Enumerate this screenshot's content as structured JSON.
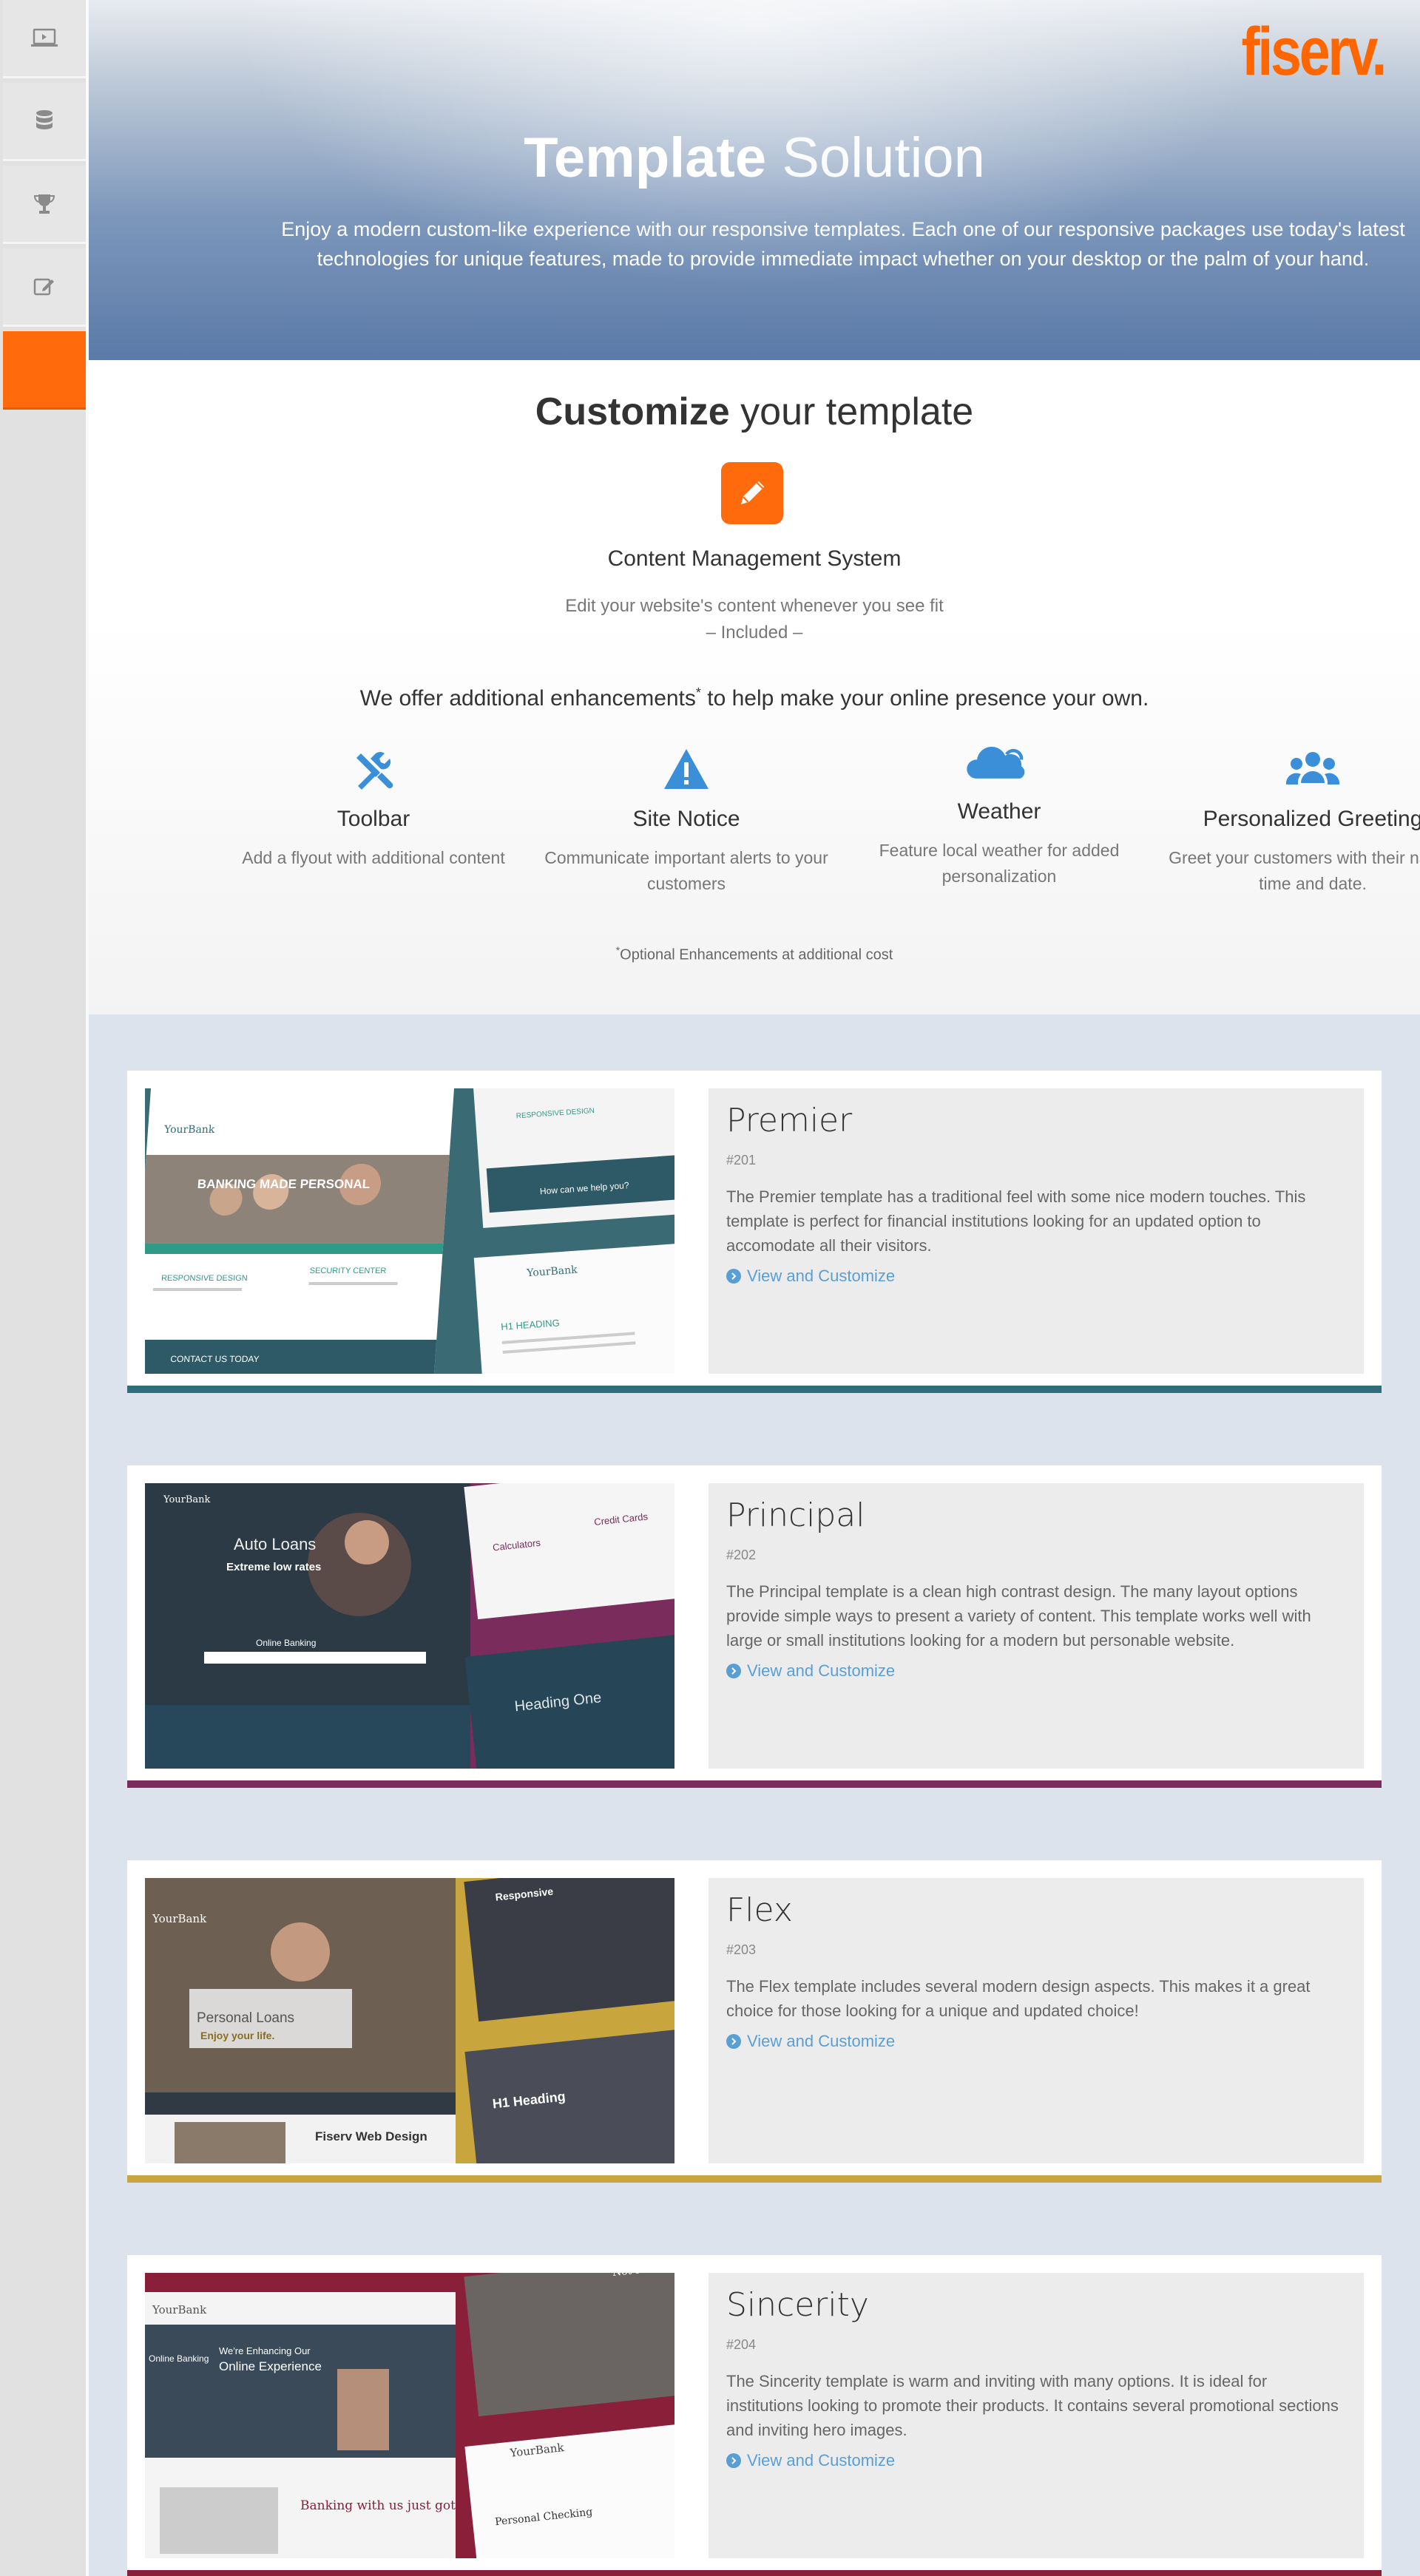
{
  "brand": {
    "logo_text": "fiserv.",
    "accent": "#ff6a0d"
  },
  "sidebar": {
    "items": [
      {
        "name": "laptop-icon",
        "active": false
      },
      {
        "name": "database-icon",
        "active": false
      },
      {
        "name": "trophy-icon",
        "active": false
      },
      {
        "name": "edit-icon",
        "active": false
      },
      {
        "name": "active-item",
        "active": true
      }
    ]
  },
  "hero": {
    "title_bold": "Template",
    "title_light": "Solution",
    "tagline": "Enjoy a modern custom-like experience with our responsive templates. Each one of our responsive packages use today's latest technologies for unique features, made to provide immediate impact whether on your desktop or the palm of your hand."
  },
  "customize": {
    "heading_bold": "Customize",
    "heading_rest": "your template",
    "cms_title": "Content Management System",
    "cms_desc": "Edit your website's content whenever you see fit",
    "cms_included": "– Included –",
    "offer_before": "We offer additional enhancements",
    "offer_sup": "*",
    "offer_after": "to help make your online presence your own.",
    "enhancements": [
      {
        "title": "Toolbar",
        "desc": "Add a flyout with additional content",
        "icon": "tools-icon"
      },
      {
        "title": "Site Notice",
        "desc": "Communicate important alerts to your customers",
        "icon": "warning-icon"
      },
      {
        "title": "Weather",
        "desc": "Feature local weather for added personalization",
        "icon": "cloud-icon"
      },
      {
        "title": "Personalized Greeting",
        "desc": "Greet your customers with their name, time and date.",
        "icon": "users-icon"
      }
    ],
    "optional_sup": "*",
    "optional_note": "Optional Enhancements at additional cost"
  },
  "templates": [
    {
      "name": "Premier",
      "number": "#201",
      "desc": "The Premier template has a traditional feel with some nice modern touches. This template is perfect for financial institutions looking for an updated option to accomodate all their visitors.",
      "link": "View and Customize",
      "color": "#2f6e7a"
    },
    {
      "name": "Principal",
      "number": "#202",
      "desc": "The Principal template is a clean high contrast design. The many layout options provide simple ways to present a variety of content. This template works well with large or small institutions looking for a modern but personable website.",
      "link": "View and Customize",
      "color": "#7a2c5c"
    },
    {
      "name": "Flex",
      "number": "#203",
      "desc": "The Flex template includes several modern design aspects. This makes it a great choice for those looking for a unique and updated choice!",
      "link": "View and Customize",
      "color": "#c9a63d"
    },
    {
      "name": "Sincerity",
      "number": "#204",
      "desc": "The Sincerity template is warm and inviting with many options. It is ideal for institutions looking to promote their products. It contains several promotional sections and inviting hero images.",
      "link": "View and Customize",
      "color": "#8a1f3a"
    }
  ],
  "screenshots": {
    "premier": {
      "brand": "YourBank",
      "hero": "BANKING MADE PERSONAL",
      "feature1": "RESPONSIVE DESIGN",
      "feature2": "SECURITY CENTER",
      "cta": "How can we help you?",
      "cta2": "CONTACT US TODAY",
      "heading": "H1 HEADING"
    },
    "principal": {
      "brand": "YourBank",
      "hero1": "Auto Loans",
      "hero2": "Extreme low rates",
      "login": "Online Banking",
      "side1": "Calculators",
      "side2": "Credit Cards",
      "heading": "Heading One"
    },
    "flex": {
      "brand": "YourBank",
      "hero1": "Personal Loans",
      "hero2": "Enjoy your life.",
      "promo": "Fiserv Web Design",
      "heading": "H1 Heading",
      "side": "Responsive"
    },
    "sincerity": {
      "brand": "YourBank",
      "hero1": "We're Enhancing Our",
      "hero2": "Online Experience",
      "login": "Online Banking",
      "promo": "Banking with us just got easier",
      "side1": "Not sure wh",
      "side2": "Personal Checking"
    }
  }
}
